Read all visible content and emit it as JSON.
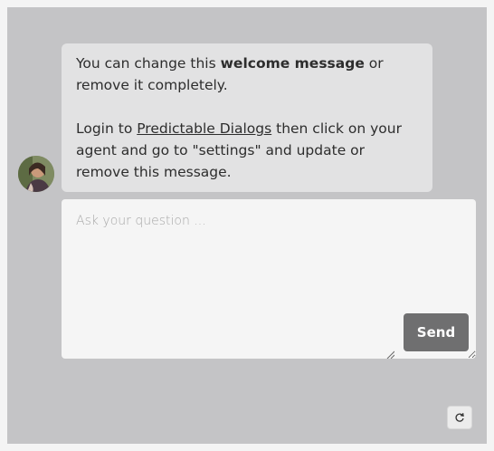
{
  "welcome": {
    "line1_prefix": "You can change this ",
    "line1_bold": "welcome message",
    "line1_suffix": " or remove it completely.",
    "line2_prefix": "Login to ",
    "line2_link": "Predictable Dialogs",
    "line2_suffix": " then click on your agent and go to \"settings\" and update or remove this message."
  },
  "composer": {
    "placeholder": "Ask your question ...",
    "send_label": "Send"
  },
  "icons": {
    "avatar": "agent-avatar",
    "refresh": "refresh-icon",
    "resize": "resize-grip-icon"
  },
  "colors": {
    "frame_bg": "#c4c4c6",
    "bubble_bg": "#e2e2e3",
    "send_bg": "#6f6f70"
  }
}
